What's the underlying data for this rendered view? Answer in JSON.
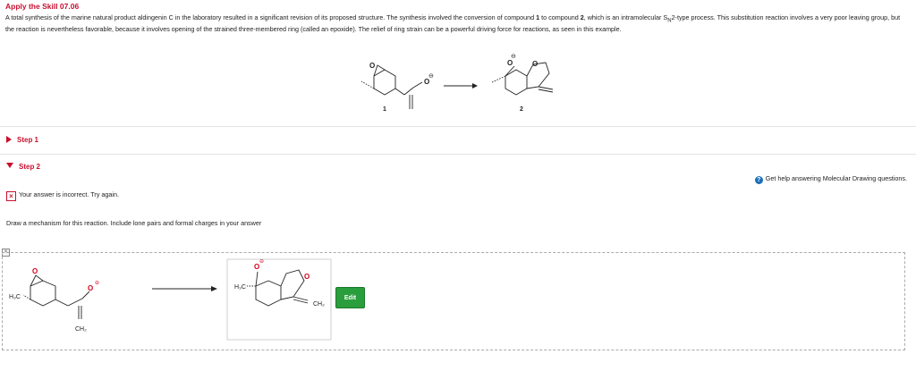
{
  "header": {
    "title": "Apply the Skill 07.06",
    "intro_part1": "A total synthesis of the marine natural product aldingenin C in the laboratory resulted in a significant revision of its proposed structure. The synthesis involved the conversion of compound ",
    "compound_1": "1",
    "intro_part2": " to compound ",
    "compound_2": "2",
    "intro_part3": ", which is an intramolecular S",
    "sn_sub": "N",
    "intro_part4": "2-type process. This substitution reaction involves a very poor leaving group, but the reaction is nevertheless favorable, because it involves opening of the strained three-membered ring (called an epoxide). The relief of ring strain can be a powerful driving force for reactions, as seen in this example."
  },
  "scheme": {
    "label_1": "1",
    "label_2": "2",
    "atom_o": "O",
    "charge_minus": "⊖"
  },
  "steps": {
    "step1_label": "Step 1",
    "step2_label": "Step 2"
  },
  "help": {
    "icon_glyph": "?",
    "text": "Get help answering Molecular Drawing questions."
  },
  "status": {
    "icon_glyph": "×",
    "text": "Your answer is incorrect.  Try again."
  },
  "instruction": "Draw a mechanism for this reaction. Include lone pairs and formal charges in your answer",
  "answer": {
    "frame_icon": "×",
    "h3c": "H₃C",
    "ch2": "CH₂",
    "atom_o": "O",
    "charge_minus": "⊖",
    "edit_label": "Edit"
  },
  "colors": {
    "accent_red": "#c8102e",
    "edit_green": "#2a9d3c",
    "help_blue": "#1d6fb8"
  }
}
